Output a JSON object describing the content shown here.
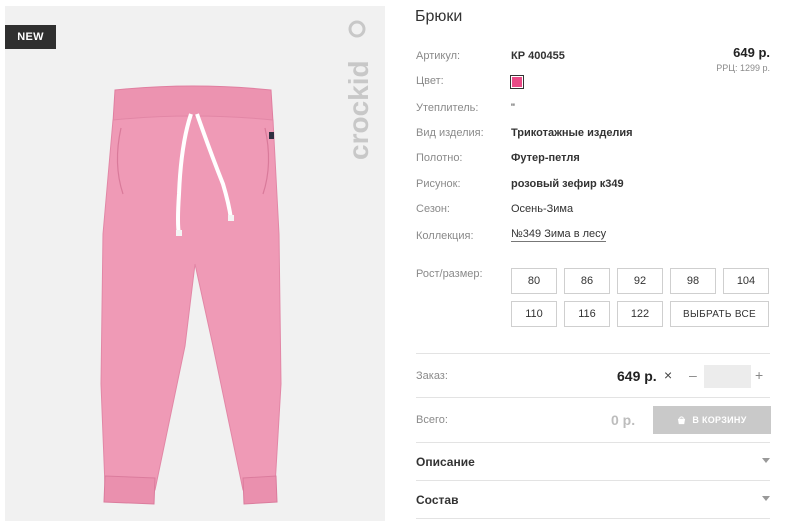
{
  "badge": "NEW",
  "brand": "crockid",
  "product": {
    "title": "Брюки",
    "price": "649 р.",
    "rrp": "РРЦ: 1299 р.",
    "color_hex": "#e94a86",
    "attributes": [
      {
        "label": "Артикул:",
        "value": "КР 400455",
        "bold": true
      },
      {
        "label": "Цвет:",
        "value": "",
        "bold": false
      },
      {
        "label": "Утеплитель:",
        "value": "\"",
        "bold": false
      },
      {
        "label": "Вид изделия:",
        "value": "Трикотажные изделия",
        "bold": true
      },
      {
        "label": "Полотно:",
        "value": "Футер-петля",
        "bold": true
      },
      {
        "label": "Рисунок:",
        "value": "розовый зефир к349",
        "bold": true
      },
      {
        "label": "Сезон:",
        "value": "Осень-Зима",
        "bold": false
      },
      {
        "label": "Коллекция:",
        "value": "№349 Зима в лесу",
        "bold": false
      }
    ]
  },
  "sizes": {
    "label": "Рост/размер:",
    "options": [
      "80",
      "86",
      "92",
      "98",
      "104",
      "110",
      "116",
      "122"
    ],
    "select_all": "ВЫБРАТЬ ВСЕ"
  },
  "order": {
    "label": "Заказ:",
    "price": "649 р.",
    "times": "×",
    "minus": "–",
    "plus": "+",
    "quantity": ""
  },
  "total": {
    "label": "Всего:",
    "value": "0 р.",
    "cart_button": "В КОРЗИНУ"
  },
  "accordions": [
    {
      "title": "Описание"
    },
    {
      "title": "Состав"
    }
  ],
  "colors": {
    "pants": "#ef9ab6",
    "panel_bg": "#f1f1f1",
    "cart_button_bg": "#c9c9c9"
  }
}
